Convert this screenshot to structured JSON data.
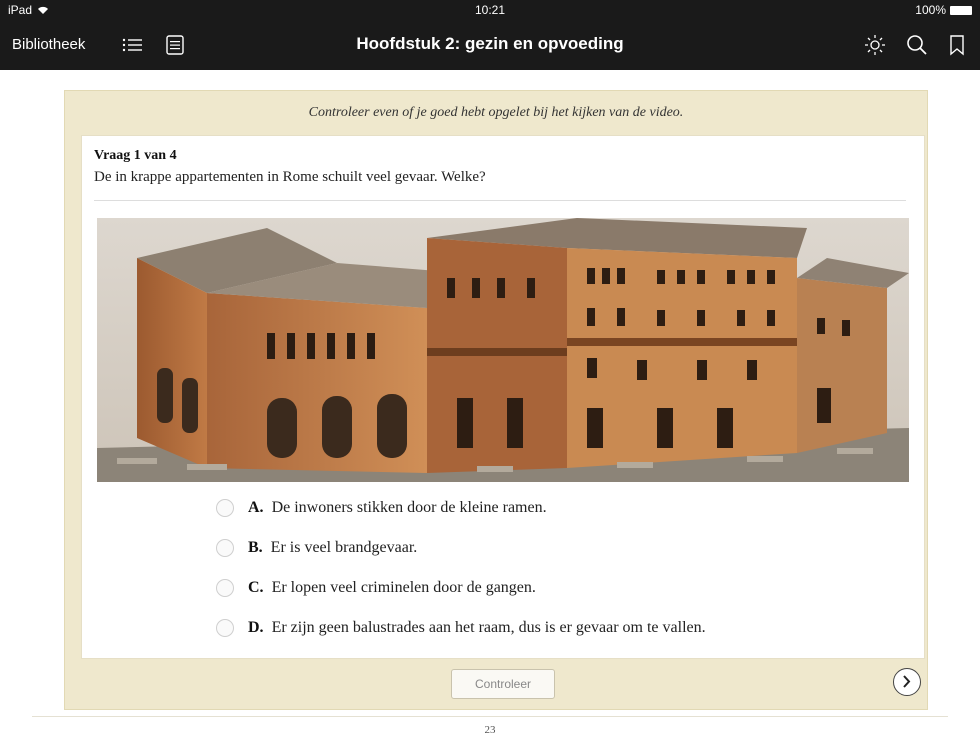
{
  "statusbar": {
    "device": "iPad",
    "time": "10:21",
    "battery": "100%"
  },
  "toolbar": {
    "library_label": "Bibliotheek",
    "title": "Hoofdstuk 2: gezin en opvoeding",
    "icons": [
      "list-icon",
      "page-icon",
      "brightness-icon",
      "search-icon",
      "bookmark-icon"
    ]
  },
  "quiz": {
    "instruction": "Controleer even of je goed hebt opgelet bij het kijken van de video.",
    "question_number": "Vraag 1 van 4",
    "question_text": "De in krappe appartementen in Rome schuilt veel gevaar. Welke?",
    "answers": [
      {
        "letter": "A.",
        "text": "De inwoners stikken door de kleine ramen."
      },
      {
        "letter": "B.",
        "text": "Er is veel brandgevaar."
      },
      {
        "letter": "C.",
        "text": "Er lopen veel criminelen door de gangen."
      },
      {
        "letter": "D.",
        "text": "Er zijn geen balustrades aan het raam, dus is er gevaar om te vallen."
      }
    ],
    "check_label": "Controleer"
  },
  "page": {
    "number": "23"
  }
}
